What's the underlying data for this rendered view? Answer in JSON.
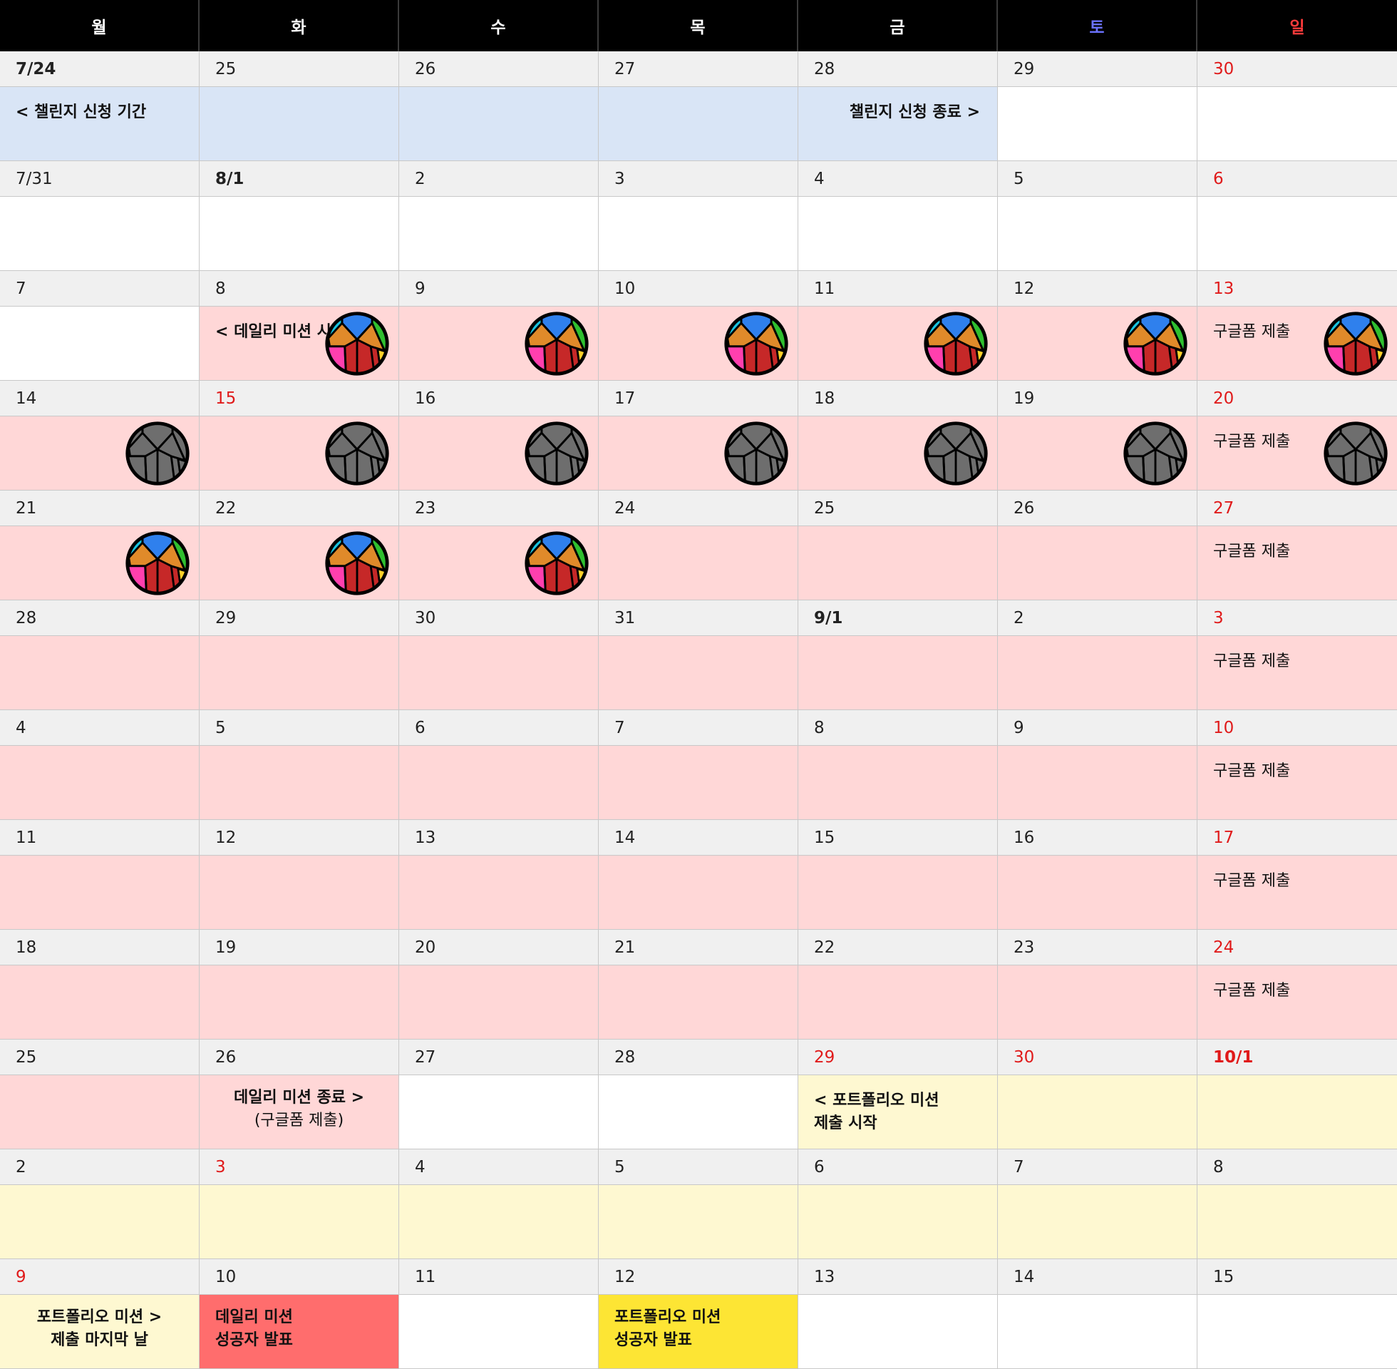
{
  "weekdays": [
    {
      "label": "월",
      "color": "#ffffff"
    },
    {
      "label": "화",
      "color": "#ffffff"
    },
    {
      "label": "수",
      "color": "#ffffff"
    },
    {
      "label": "목",
      "color": "#ffffff"
    },
    {
      "label": "금",
      "color": "#ffffff"
    },
    {
      "label": "토",
      "color": "#6b72ff"
    },
    {
      "label": "일",
      "color": "#ff3b3b"
    }
  ],
  "colors": {
    "blue": "#d9e5f6",
    "pink": "#ffd7d7",
    "yellow": "#fef8d1",
    "white": "#ffffff",
    "red": "#ff6d6d",
    "gold": "#fde534",
    "holiday_text": "#e01a1a"
  },
  "weeks": [
    {
      "dates": [
        {
          "text": "7/24",
          "bold": true
        },
        {
          "text": "25"
        },
        {
          "text": "26"
        },
        {
          "text": "27"
        },
        {
          "text": "28"
        },
        {
          "text": "29"
        },
        {
          "text": "30",
          "red": true
        }
      ],
      "events": [
        {
          "bg": "blue",
          "text": "<  챌린지 신청 기간",
          "bold": true
        },
        {
          "bg": "blue"
        },
        {
          "bg": "blue"
        },
        {
          "bg": "blue"
        },
        {
          "bg": "blue",
          "text": "챌린지 신청 종료 >",
          "bold": true,
          "align": "right"
        },
        {
          "bg": "white"
        },
        {
          "bg": "white"
        }
      ]
    },
    {
      "dates": [
        {
          "text": "7/31"
        },
        {
          "text": "8/1",
          "bold": true
        },
        {
          "text": "2"
        },
        {
          "text": "3"
        },
        {
          "text": "4"
        },
        {
          "text": "5"
        },
        {
          "text": "6",
          "red": true
        }
      ],
      "events": [
        {
          "bg": "white"
        },
        {
          "bg": "white"
        },
        {
          "bg": "white"
        },
        {
          "bg": "white"
        },
        {
          "bg": "white"
        },
        {
          "bg": "white"
        },
        {
          "bg": "white"
        }
      ]
    },
    {
      "dates": [
        {
          "text": "7"
        },
        {
          "text": "8"
        },
        {
          "text": "9"
        },
        {
          "text": "10"
        },
        {
          "text": "11"
        },
        {
          "text": "12"
        },
        {
          "text": "13",
          "red": true
        }
      ],
      "events": [
        {
          "bg": "white"
        },
        {
          "bg": "pink",
          "text": "< 데일리 미션 시",
          "bold": true,
          "badge": "color"
        },
        {
          "bg": "pink",
          "badge": "color"
        },
        {
          "bg": "pink",
          "badge": "color"
        },
        {
          "bg": "pink",
          "badge": "color"
        },
        {
          "bg": "pink",
          "badge": "color"
        },
        {
          "bg": "pink",
          "text": "구글폼 제출",
          "badge": "color"
        }
      ]
    },
    {
      "dates": [
        {
          "text": "14"
        },
        {
          "text": "15",
          "red": true
        },
        {
          "text": "16"
        },
        {
          "text": "17"
        },
        {
          "text": "18"
        },
        {
          "text": "19"
        },
        {
          "text": "20",
          "red": true
        }
      ],
      "events": [
        {
          "bg": "pink",
          "badge": "gray"
        },
        {
          "bg": "pink",
          "badge": "gray"
        },
        {
          "bg": "pink",
          "badge": "gray"
        },
        {
          "bg": "pink",
          "badge": "gray"
        },
        {
          "bg": "pink",
          "badge": "gray"
        },
        {
          "bg": "pink",
          "badge": "gray"
        },
        {
          "bg": "pink",
          "text": "구글폼 제출",
          "badge": "gray"
        }
      ]
    },
    {
      "dates": [
        {
          "text": "21"
        },
        {
          "text": "22"
        },
        {
          "text": "23"
        },
        {
          "text": "24"
        },
        {
          "text": "25"
        },
        {
          "text": "26"
        },
        {
          "text": "27",
          "red": true
        }
      ],
      "events": [
        {
          "bg": "pink",
          "badge": "color"
        },
        {
          "bg": "pink",
          "badge": "color"
        },
        {
          "bg": "pink",
          "badge": "color"
        },
        {
          "bg": "pink"
        },
        {
          "bg": "pink"
        },
        {
          "bg": "pink"
        },
        {
          "bg": "pink",
          "text": "구글폼 제출"
        }
      ]
    },
    {
      "dates": [
        {
          "text": "28"
        },
        {
          "text": "29"
        },
        {
          "text": "30"
        },
        {
          "text": "31"
        },
        {
          "text": "9/1",
          "bold": true
        },
        {
          "text": "2"
        },
        {
          "text": "3",
          "red": true
        }
      ],
      "events": [
        {
          "bg": "pink"
        },
        {
          "bg": "pink"
        },
        {
          "bg": "pink"
        },
        {
          "bg": "pink"
        },
        {
          "bg": "pink"
        },
        {
          "bg": "pink"
        },
        {
          "bg": "pink",
          "text": "구글폼 제출"
        }
      ]
    },
    {
      "dates": [
        {
          "text": "4"
        },
        {
          "text": "5"
        },
        {
          "text": "6"
        },
        {
          "text": "7"
        },
        {
          "text": "8"
        },
        {
          "text": "9"
        },
        {
          "text": "10",
          "red": true
        }
      ],
      "events": [
        {
          "bg": "pink"
        },
        {
          "bg": "pink"
        },
        {
          "bg": "pink"
        },
        {
          "bg": "pink"
        },
        {
          "bg": "pink"
        },
        {
          "bg": "pink"
        },
        {
          "bg": "pink",
          "text": "구글폼 제출"
        }
      ]
    },
    {
      "dates": [
        {
          "text": "11"
        },
        {
          "text": "12"
        },
        {
          "text": "13"
        },
        {
          "text": "14"
        },
        {
          "text": "15"
        },
        {
          "text": "16"
        },
        {
          "text": "17",
          "red": true
        }
      ],
      "events": [
        {
          "bg": "pink"
        },
        {
          "bg": "pink"
        },
        {
          "bg": "pink"
        },
        {
          "bg": "pink"
        },
        {
          "bg": "pink"
        },
        {
          "bg": "pink"
        },
        {
          "bg": "pink",
          "text": "구글폼 제출"
        }
      ]
    },
    {
      "dates": [
        {
          "text": "18"
        },
        {
          "text": "19"
        },
        {
          "text": "20"
        },
        {
          "text": "21"
        },
        {
          "text": "22"
        },
        {
          "text": "23"
        },
        {
          "text": "24",
          "red": true
        }
      ],
      "events": [
        {
          "bg": "pink"
        },
        {
          "bg": "pink"
        },
        {
          "bg": "pink"
        },
        {
          "bg": "pink"
        },
        {
          "bg": "pink"
        },
        {
          "bg": "pink"
        },
        {
          "bg": "pink",
          "text": "구글폼 제출"
        }
      ]
    },
    {
      "dates": [
        {
          "text": "25"
        },
        {
          "text": "26"
        },
        {
          "text": "27"
        },
        {
          "text": "28"
        },
        {
          "text": "29",
          "red": true
        },
        {
          "text": "30",
          "red": true
        },
        {
          "text": "10/1",
          "red": true,
          "bold": true
        }
      ],
      "events": [
        {
          "bg": "pink"
        },
        {
          "bg": "pink",
          "text": "데일리 미션 종료  >",
          "bold": true,
          "sub": "(구글폼 제출)",
          "align": "center"
        },
        {
          "bg": "white"
        },
        {
          "bg": "white"
        },
        {
          "bg": "yellow",
          "text": "< 포트폴리오 미션\n   제출 시작",
          "bold": true
        },
        {
          "bg": "yellow"
        },
        {
          "bg": "yellow"
        }
      ]
    },
    {
      "dates": [
        {
          "text": "2"
        },
        {
          "text": "3",
          "red": true
        },
        {
          "text": "4"
        },
        {
          "text": "5"
        },
        {
          "text": "6"
        },
        {
          "text": "7"
        },
        {
          "text": "8"
        }
      ],
      "events": [
        {
          "bg": "yellow"
        },
        {
          "bg": "yellow"
        },
        {
          "bg": "yellow"
        },
        {
          "bg": "yellow"
        },
        {
          "bg": "yellow"
        },
        {
          "bg": "yellow"
        },
        {
          "bg": "yellow"
        }
      ]
    },
    {
      "dates": [
        {
          "text": "9",
          "red": true
        },
        {
          "text": "10"
        },
        {
          "text": "11"
        },
        {
          "text": "12"
        },
        {
          "text": "13"
        },
        {
          "text": "14"
        },
        {
          "text": "15"
        }
      ],
      "events": [
        {
          "bg": "yellow",
          "text": "포트폴리오 미션  >\n제출 마지막 날",
          "bold": true,
          "align": "center"
        },
        {
          "bg": "red",
          "text": "데일리 미션\n성공자 발표",
          "bold": true,
          "align": "pad"
        },
        {
          "bg": "white"
        },
        {
          "bg": "gold",
          "text": "포트폴리오 미션\n성공자 발표",
          "bold": true,
          "align": "pad"
        },
        {
          "bg": "white"
        },
        {
          "bg": "white"
        },
        {
          "bg": "white"
        }
      ]
    }
  ]
}
